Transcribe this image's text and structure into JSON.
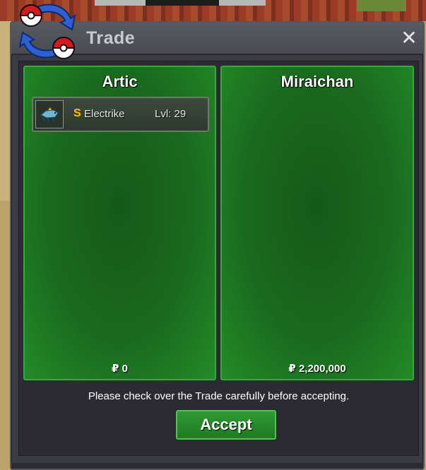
{
  "window": {
    "title": "Trade",
    "close_symbol": "✕",
    "logo_icon": "trade-pokeball-arrows-icon"
  },
  "panels": [
    {
      "name": "Artic",
      "currency_symbol": "₽",
      "money": "0",
      "items": [
        {
          "icon": "electrike-sprite-icon",
          "shiny_mark": "S",
          "name": "Electrike",
          "level": "Lvl: 29"
        }
      ]
    },
    {
      "name": "Miraichan",
      "currency_symbol": "₽",
      "money": "2,200,000",
      "items": []
    }
  ],
  "footer": {
    "notice": "Please check over the Trade carefully before accepting.",
    "accept_label": "Accept"
  },
  "colors": {
    "panel_green": "#1a6a1e",
    "accept_green": "#2e9a33",
    "shiny_gold": "#f1c40f"
  }
}
